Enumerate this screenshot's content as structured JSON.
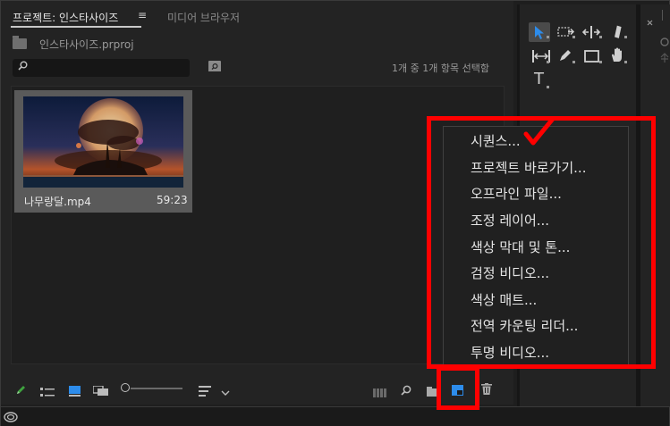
{
  "project_panel": {
    "tabs": [
      {
        "label": "프로젝트: 인스타사이즈"
      },
      {
        "label": "미디어 브라우저"
      }
    ],
    "menu_glyph": "≡",
    "project_file": "인스타사이즈.prproj",
    "search": {
      "value": "",
      "placeholder": ""
    },
    "selection_count": "1개 중 1개 항목 선택함",
    "clip": {
      "name": "나무랑달.mp4",
      "duration": "59:23"
    }
  },
  "context_menu": {
    "items": [
      "시퀀스...",
      "프로젝트 바로가기...",
      "오프라인 파일...",
      "조정 레이어...",
      "색상 막대 및 톤...",
      "검정 비디오...",
      "색상 매트...",
      "전역 카운팅 리더...",
      "투명 비디오..."
    ]
  },
  "tools": {
    "text_tool_glyph": "T"
  },
  "icons": {
    "pencil": "pencil-icon",
    "list_view": "list-view-icon",
    "icon_view": "icon-view-icon",
    "freeform_view": "freeform-view-icon",
    "sort": "sort-icon",
    "automate": "automate-to-sequence-icon",
    "find": "find-icon",
    "new_bin": "new-bin-icon",
    "new_item": "new-item-icon",
    "clear": "trash-icon"
  },
  "colors": {
    "accent": "#2d8ceb",
    "highlight": "#ff0000",
    "pencil": "#3fa33f"
  }
}
